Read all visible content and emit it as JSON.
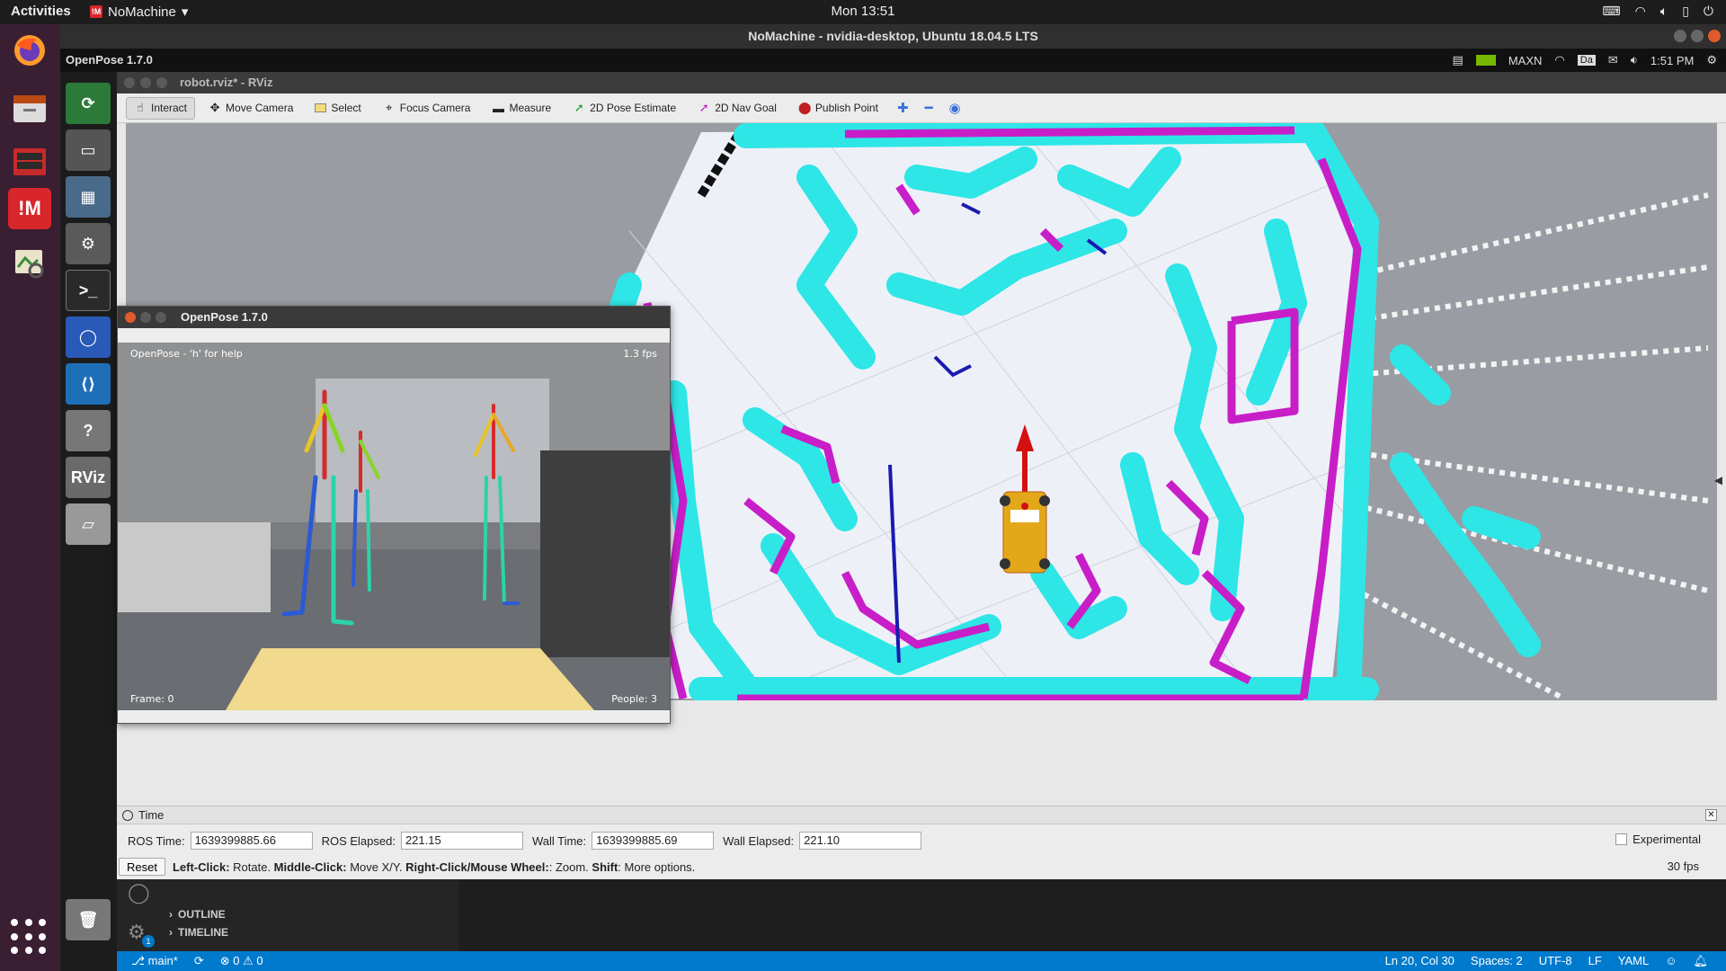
{
  "topbar": {
    "activities": "Activities",
    "app_menu": "NoMachine",
    "clock": "Mon 13:51"
  },
  "nomachine": {
    "title": "NoMachine - nvidia-desktop, Ubuntu 18.04.5 LTS"
  },
  "inner_desktop": {
    "title": "OpenPose 1.7.0",
    "power_mode": "MAXN",
    "keyboard": "Da",
    "time": "1:51 PM",
    "launcher_rviz": "RViz"
  },
  "rviz": {
    "title": "robot.rviz* - RViz",
    "tools": [
      {
        "label": "Interact",
        "icon": "hand-icon"
      },
      {
        "label": "Move Camera",
        "icon": "move-icon"
      },
      {
        "label": "Select",
        "icon": "select-icon"
      },
      {
        "label": "Focus Camera",
        "icon": "focus-icon"
      },
      {
        "label": "Measure",
        "icon": "ruler-icon"
      },
      {
        "label": "2D Pose Estimate",
        "icon": "pose-arrow-icon"
      },
      {
        "label": "2D Nav Goal",
        "icon": "goal-arrow-icon"
      },
      {
        "label": "Publish Point",
        "icon": "map-pin-icon"
      }
    ],
    "colors": {
      "cyan": "#2ee6e6",
      "magenta": "#c81ec8",
      "floor": "#eef0f8",
      "unknown": "#999ca2",
      "robot": "#e2a81a",
      "arrow": "#d41010"
    }
  },
  "openpose": {
    "title": "OpenPose 1.7.0",
    "help_text": "OpenPose - 'h' for help",
    "fps_text": "1.3 fps",
    "frame_text": "Frame: 0",
    "people_text": "People: 3"
  },
  "time_panel": {
    "title": "Time",
    "ros_time_label": "ROS Time:",
    "ros_time": "1639399885.66",
    "ros_elapsed_label": "ROS Elapsed:",
    "ros_elapsed": "221.15",
    "wall_time_label": "Wall Time:",
    "wall_time": "1639399885.69",
    "wall_elapsed_label": "Wall Elapsed:",
    "wall_elapsed": "221.10",
    "experimental_label": "Experimental",
    "reset_label": "Reset",
    "hint_left": "Left-Click:",
    "hint_left_desc": " Rotate. ",
    "hint_middle": "Middle-Click:",
    "hint_middle_desc": " Move X/Y. ",
    "hint_right": "Right-Click/Mouse Wheel:",
    "hint_right_desc": ": Zoom. ",
    "hint_shift": "Shift",
    "hint_shift_desc": ": More options.",
    "fps": "30 fps"
  },
  "vscode": {
    "outline": "OUTLINE",
    "timeline": "TIMELINE",
    "badge": "1",
    "status": {
      "branch": "main*",
      "problems": "0 ⚠ 0",
      "position": "Ln 20, Col 30",
      "spaces": "Spaces: 2",
      "encoding": "UTF-8",
      "eol": "LF",
      "language": "YAML"
    }
  }
}
